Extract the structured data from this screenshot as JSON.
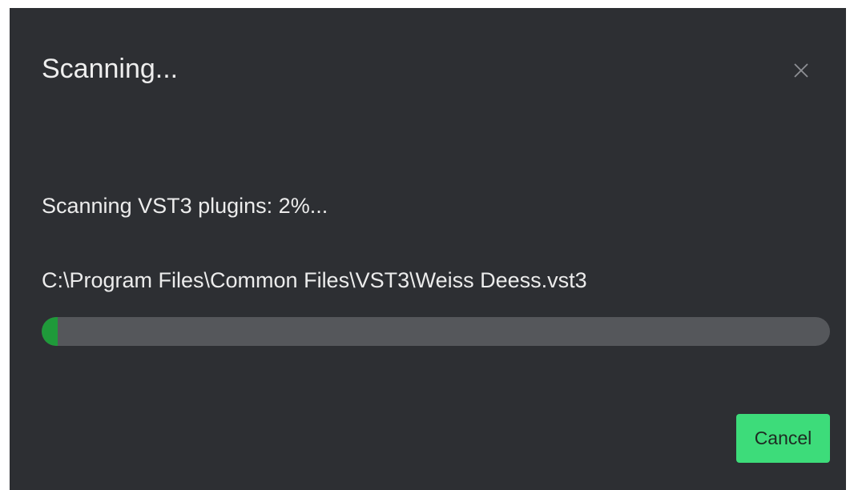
{
  "dialog": {
    "title": "Scanning...",
    "close_icon": "close-icon",
    "status_text": "Scanning VST3 plugins: 2%...",
    "current_file": "C:\\Program Files\\Common Files\\VST3\\Weiss Deess.vst3",
    "progress_percent": 2,
    "cancel_label": "Cancel"
  },
  "colors": {
    "background": "#2d2f33",
    "progress_track": "#55575b",
    "progress_fill": "#1f9a3a",
    "accent_button": "#3ddc7a"
  }
}
